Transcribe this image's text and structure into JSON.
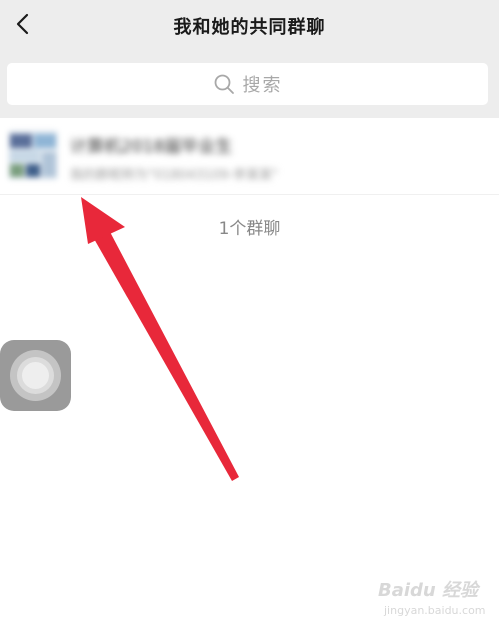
{
  "header": {
    "title": "我和她的共同群聊",
    "back_icon": "chevron-left-icon"
  },
  "search": {
    "placeholder": "搜索",
    "icon": "search-icon"
  },
  "groups": [
    {
      "name": "计算机2018届毕业生",
      "subtitle": "我的群昵称为\"018043109-李某某\""
    }
  ],
  "footer": {
    "count_label": "1个群聊"
  },
  "overlay": {
    "annotation_color": "#e8283a",
    "assistive_touch_icon": "assistive-touch-icon"
  },
  "watermark": {
    "logo_text": "Baidu 经验",
    "url": "jingyan.baidu.com"
  }
}
